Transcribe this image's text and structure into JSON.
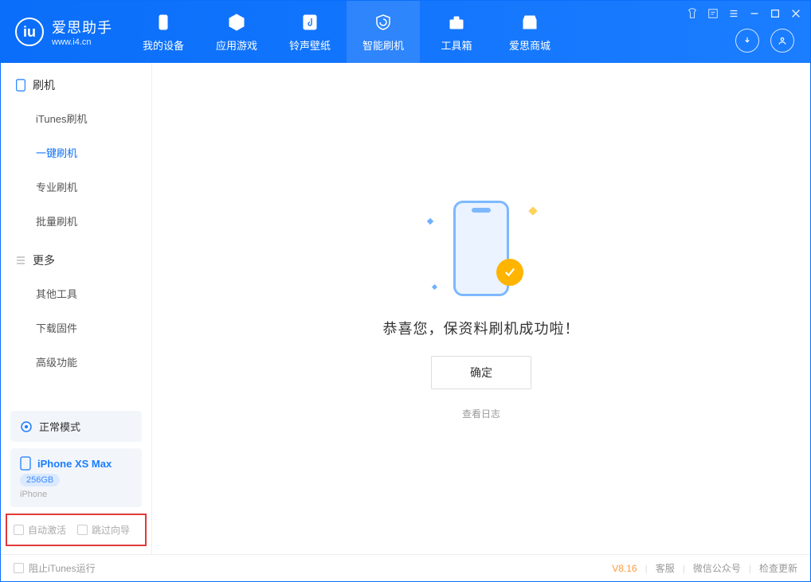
{
  "brand": {
    "name": "爱思助手",
    "url": "www.i4.cn"
  },
  "nav": {
    "items": [
      {
        "label": "我的设备"
      },
      {
        "label": "应用游戏"
      },
      {
        "label": "铃声壁纸"
      },
      {
        "label": "智能刷机"
      },
      {
        "label": "工具箱"
      },
      {
        "label": "爱思商城"
      }
    ]
  },
  "sidebar": {
    "group1_title": "刷机",
    "group1_items": [
      {
        "label": "iTunes刷机"
      },
      {
        "label": "一键刷机"
      },
      {
        "label": "专业刷机"
      },
      {
        "label": "批量刷机"
      }
    ],
    "group2_title": "更多",
    "group2_items": [
      {
        "label": "其他工具"
      },
      {
        "label": "下载固件"
      },
      {
        "label": "高级功能"
      }
    ],
    "mode_label": "正常模式",
    "device": {
      "name": "iPhone XS Max",
      "storage": "256GB",
      "type": "iPhone"
    },
    "option_auto_activate": "自动激活",
    "option_skip_guide": "跳过向导"
  },
  "main": {
    "success_message": "恭喜您，保资料刷机成功啦！",
    "ok_button": "确定",
    "view_log": "查看日志"
  },
  "footer": {
    "block_itunes": "阻止iTunes运行",
    "version": "V8.16",
    "links": {
      "service": "客服",
      "wechat": "微信公众号",
      "update": "检查更新"
    }
  }
}
